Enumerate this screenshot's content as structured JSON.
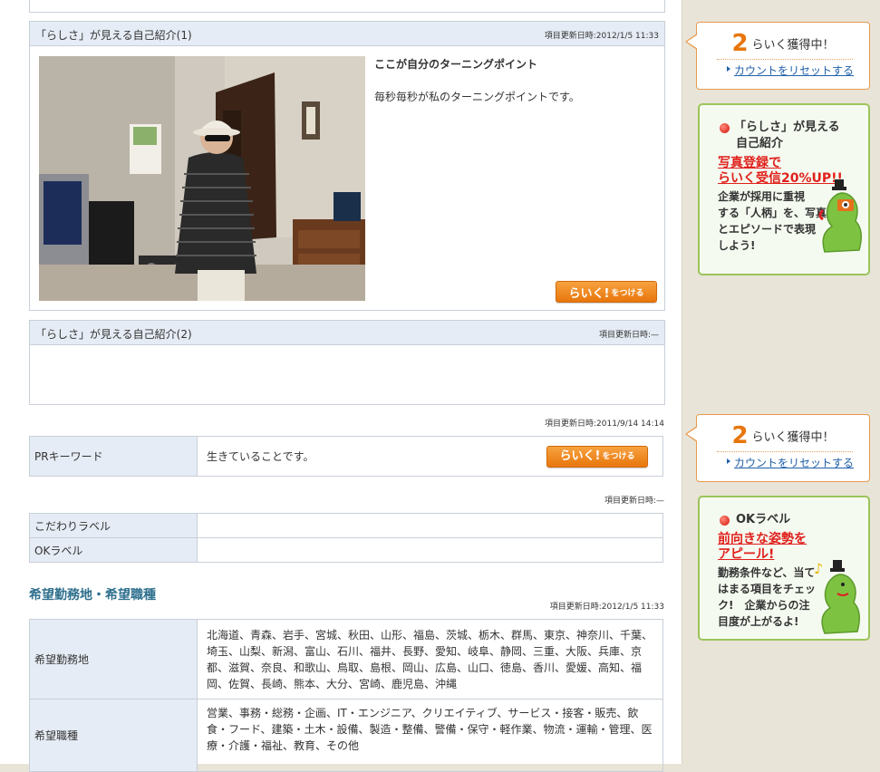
{
  "intro1": {
    "title": "「らしさ」が見える自己紹介(1)",
    "date": "項目更新日時:2012/1/5 11:33",
    "heading": "ここが自分のターニングポイント",
    "body": "毎秒毎秒が私のターニングポイントです。",
    "photo_alt": "自己紹介写真"
  },
  "rakku_button": {
    "big": "らいく!",
    "small": "をつける"
  },
  "intro2": {
    "title": "「らしさ」が見える自己紹介(2)",
    "date": "項目更新日時:—"
  },
  "pr": {
    "date": "項目更新日時:2011/9/14 14:14",
    "label": "PRキーワード",
    "value": "生きていることです。"
  },
  "labels": {
    "date": "項目更新日時:—",
    "rows": [
      {
        "label": "こだわりラベル",
        "value": ""
      },
      {
        "label": "OKラベル",
        "value": ""
      }
    ]
  },
  "wish": {
    "title": "希望勤務地・希望職種",
    "date": "項目更新日時:2012/1/5 11:33",
    "rows": [
      {
        "label": "希望勤務地",
        "value": "北海道、青森、岩手、宮城、秋田、山形、福島、茨城、栃木、群馬、東京、神奈川、千葉、埼玉、山梨、新潟、富山、石川、福井、長野、愛知、岐阜、静岡、三重、大阪、兵庫、京都、滋賀、奈良、和歌山、鳥取、島根、岡山、広島、山口、徳島、香川、愛媛、高知、福岡、佐賀、長崎、熊本、大分、宮崎、鹿児島、沖縄"
      },
      {
        "label": "希望職種",
        "value": "営業、事務・総務・企画、IT・エンジニア、クリエイティブ、サービス・接客・販売、飲食・フード、建築・土木・設備、製造・整備、警備・保守・軽作業、物流・運輸・管理、医療・介護・福祉、教育、その他"
      }
    ]
  },
  "sidebar": {
    "count1": {
      "num": "2",
      "text": "らいく獲得中！",
      "reset": "カウントをリセットする"
    },
    "promo1": {
      "title_l1": "「らしさ」が見える",
      "title_l2": "自己紹介",
      "red_l1": "写真登録で",
      "red_l2": "らいく受信20%UP!!",
      "body": [
        "企業が採用に重視",
        "する「人柄」を、写真",
        "とエピソードで表現",
        "しよう!"
      ]
    },
    "count2": {
      "num": "2",
      "text": "らいく獲得中！",
      "reset": "カウントをリセットする"
    },
    "promo2": {
      "title_l1": "OKラベル",
      "red_l1": "前向きな姿勢を",
      "red_l2": "アピール!",
      "body": [
        "勤務条件など、当て",
        "はまる項目をチェッ",
        "ク!　企業からの注",
        "目度が上がるよ!"
      ]
    },
    "colors": {
      "accent_orange": "#e8760c",
      "link_blue": "#1f5fa8",
      "promo_green": "#9bc55a",
      "promo_red": "#e0201c",
      "header_blue": "#e6ecf5"
    }
  }
}
